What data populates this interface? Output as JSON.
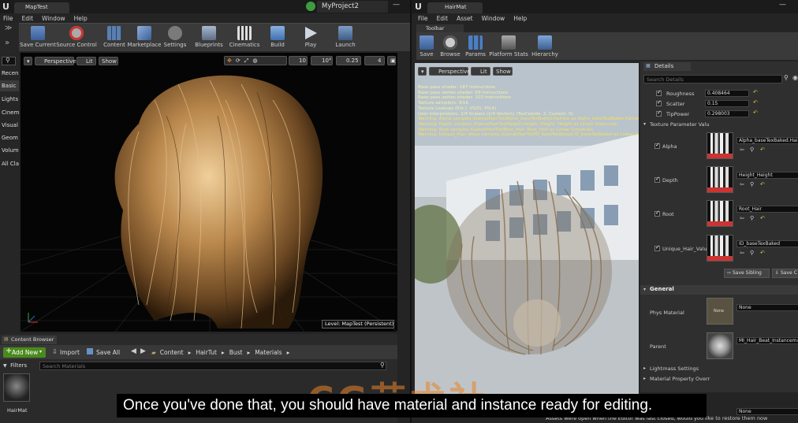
{
  "left_window": {
    "tab_title": "MapTest",
    "project_name": "MyProject2",
    "menu": [
      "File",
      "Edit",
      "Window",
      "Help"
    ],
    "toolbar": [
      {
        "label": "Save Current",
        "icon": "save-icon"
      },
      {
        "label": "Source Control",
        "icon": "source-control-icon"
      },
      {
        "label": "Content",
        "icon": "content-icon"
      },
      {
        "label": "Marketplace",
        "icon": "marketplace-icon"
      },
      {
        "label": "Settings",
        "icon": "settings-icon"
      },
      {
        "label": "Blueprints",
        "icon": "blueprints-icon"
      },
      {
        "label": "Cinematics",
        "icon": "cinematics-icon"
      },
      {
        "label": "Build",
        "icon": "build-icon"
      },
      {
        "label": "Play",
        "icon": "play-icon"
      },
      {
        "label": "Launch",
        "icon": "launch-icon"
      }
    ],
    "sidebar": [
      "Recen",
      "Basic",
      "Lights",
      "Cinem",
      "Visual",
      "Geom",
      "Volum",
      "All Cla"
    ],
    "viewport": {
      "perspective": "Perspective",
      "lit": "Lit",
      "show": "Show",
      "grid_snap": "10",
      "rot_snap": "10°",
      "scale_snap": "0.25",
      "camera_speed": "4",
      "level_label": "Level:  MapTest (Persistent)"
    },
    "content_browser": {
      "tab": "Content Browser",
      "add_new": "Add New",
      "import": "Import",
      "save_all": "Save All",
      "path": [
        "Content",
        "HairTut",
        "Bust",
        "Materials"
      ],
      "filters": "Filters",
      "search_placeholder": "Search Materials",
      "asset_name": "HairMat"
    }
  },
  "right_window": {
    "tab_title": "HairMat",
    "menu": [
      "File",
      "Edit",
      "Asset",
      "Window",
      "Help"
    ],
    "toolbar_tab": "Toolbar",
    "toolbar": [
      {
        "label": "Save",
        "icon": "save-icon"
      },
      {
        "label": "Browse",
        "icon": "browse-icon"
      },
      {
        "label": "Params",
        "icon": "params-icon"
      },
      {
        "label": "Platform Stats",
        "icon": "platform-stats-icon"
      },
      {
        "label": "Hierarchy",
        "icon": "hierarchy-icon"
      }
    ],
    "viewport": {
      "perspective": "Perspective",
      "lit": "Lit",
      "show": "Show",
      "stats": [
        "Base pass shader: 187 instructions",
        "Base pass vertex shader: 69 instructions",
        "Base pass vertex shader: 103 instructions",
        "Texture samplers: 3/16",
        "Texture Lookups (Est.): VS(0), PS(4)",
        "User interpolators: 2/4 Scalars (1/4 Vectors) (TexCoords: 2, Custom: 0)",
        "Warning: Alpha samples /Game/HairTut/Alpha_baseTexBaked.Hairww as Alpha_baseTexBaked.Hairww as",
        "Warning: Depth samples /Game/HairTut/Height.Height, Height. Height as Linear Greyscale.",
        "Warning: Root samples /Game/HairTut/Root_Hair. Root_Hair as Linear Greyscale.",
        "Warning: Unique_Hair_Value samples /Game/HairTut/ID_baseTexBaked.ID_baseTexBaked as Linear G"
      ]
    },
    "details": {
      "tab": "Details",
      "search_placeholder": "Search Details",
      "scalar_params": [
        {
          "name": "Roughness",
          "value": "0.408464"
        },
        {
          "name": "Scatter",
          "value": "0.15"
        },
        {
          "name": "TipPower",
          "value": "0.298003"
        }
      ],
      "texture_section": "Texture Parameter Valu",
      "texture_params": [
        {
          "name": "Alpha",
          "value": "Alpha_baseTexBaked.Hairww"
        },
        {
          "name": "Depth",
          "value": "Height_Height"
        },
        {
          "name": "Root",
          "value": "Root_Hair"
        },
        {
          "name": "Unique_Hair_Value",
          "value": "ID_baseTexBaked"
        }
      ],
      "save_sibling": "Save Sibling",
      "save_child": "Save C",
      "general_section": "General",
      "phys_material_label": "Phys Material",
      "phys_material_thumb": "None",
      "phys_material_value": "None",
      "parent_label": "Parent",
      "parent_value": "MI_Hair_Beat_Instancemat",
      "lightmass": "Lightmass Settings",
      "material_property": "Material Property Overr",
      "bottom_value": "None"
    }
  },
  "notification": "Assets were open when the Editor was last closed, would you like to restore them now",
  "subtitle": "Once you've done that, you should have material and instance ready for editing.",
  "watermark": "CG艺术社",
  "colors": {
    "accent_green": "#4a8a1c",
    "menu_bg": "#2a2a2a",
    "toolbar_bg": "#3c3c3c",
    "selection_orange": "#d9922e"
  }
}
